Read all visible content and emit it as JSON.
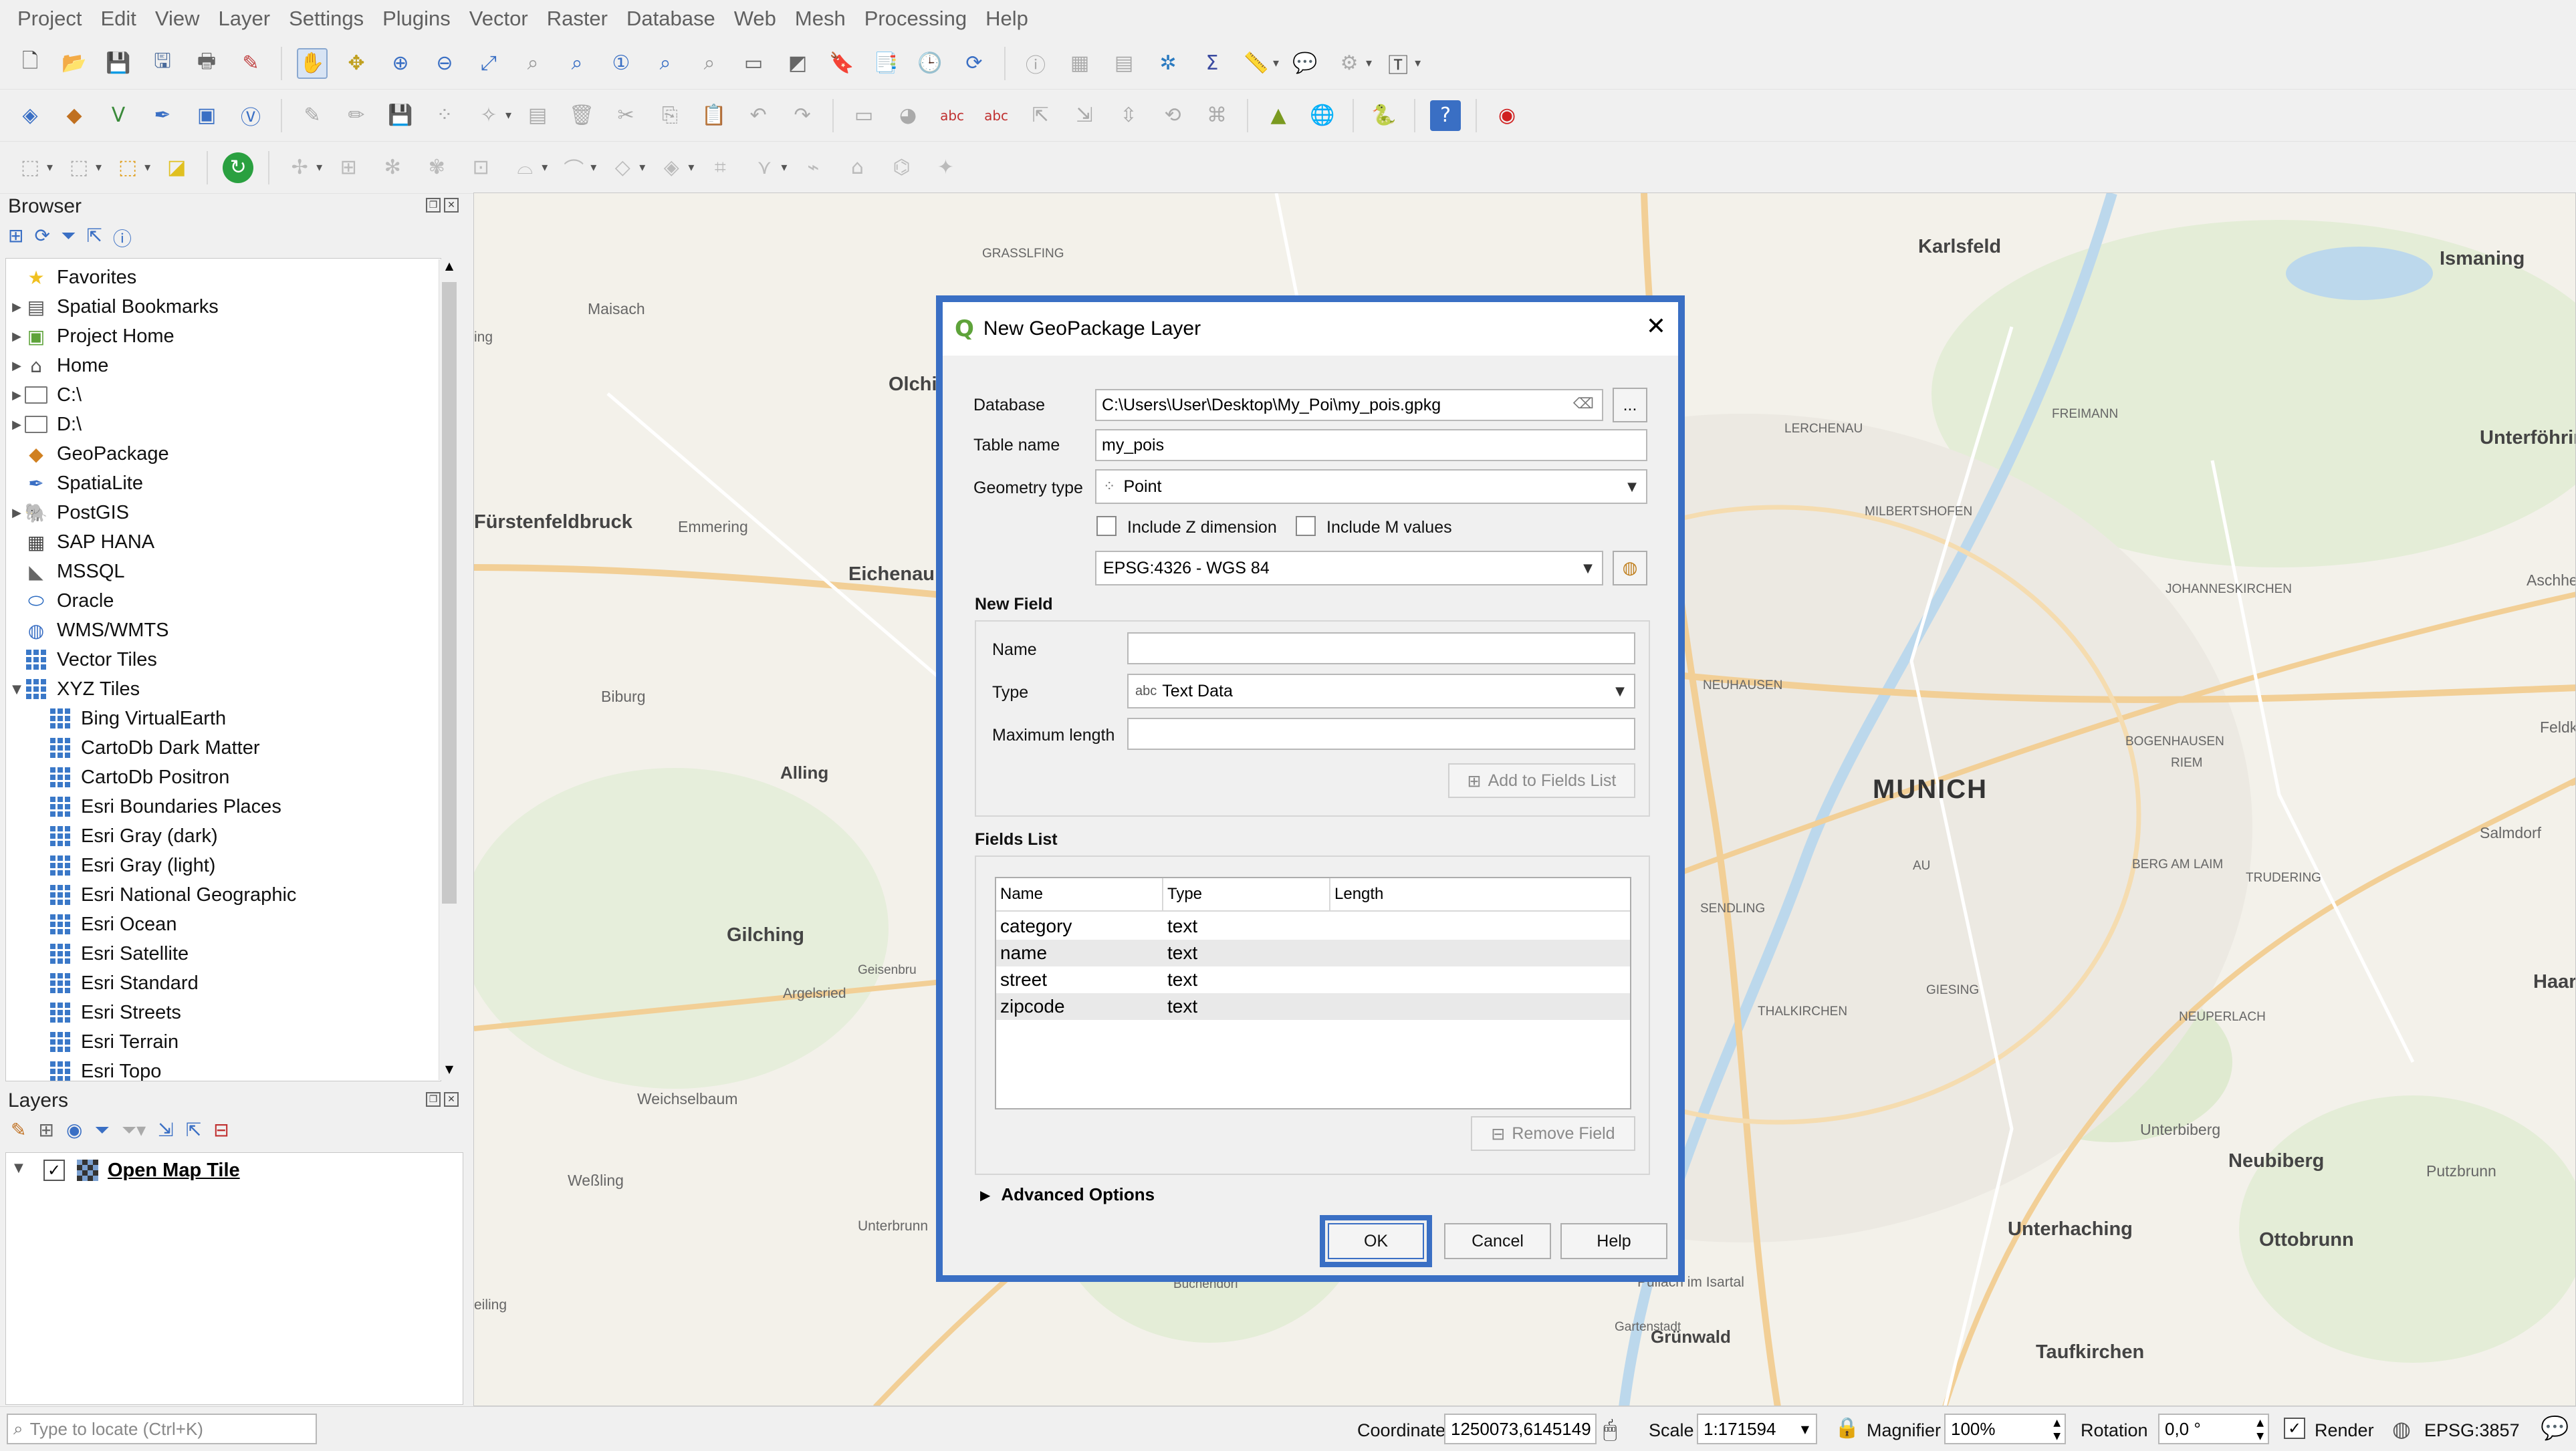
{
  "menu": [
    "Project",
    "Edit",
    "View",
    "Layer",
    "Settings",
    "Plugins",
    "Vector",
    "Raster",
    "Database",
    "Web",
    "Mesh",
    "Processing",
    "Help"
  ],
  "browser": {
    "title": "Browser",
    "items": [
      {
        "label": "Favorites",
        "icon": "star-icon"
      },
      {
        "label": "Spatial Bookmarks",
        "icon": "bookmark-icon"
      },
      {
        "label": "Project Home",
        "icon": "project-home-icon"
      },
      {
        "label": "Home",
        "icon": "home-icon"
      },
      {
        "label": "C:\\",
        "icon": "folder-icon"
      },
      {
        "label": "D:\\",
        "icon": "folder-icon"
      },
      {
        "label": "GeoPackage",
        "icon": "geopackage-icon"
      },
      {
        "label": "SpatiaLite",
        "icon": "spatialite-icon"
      },
      {
        "label": "PostGIS",
        "icon": "postgis-icon"
      },
      {
        "label": "SAP HANA",
        "icon": "sap-hana-icon"
      },
      {
        "label": "MSSQL",
        "icon": "mssql-icon"
      },
      {
        "label": "Oracle",
        "icon": "oracle-icon"
      },
      {
        "label": "WMS/WMTS",
        "icon": "globe-icon"
      },
      {
        "label": "Vector Tiles",
        "icon": "grid-icon"
      },
      {
        "label": "XYZ Tiles",
        "icon": "grid-icon"
      },
      {
        "label": "Bing VirtualEarth",
        "icon": "grid-icon"
      },
      {
        "label": "CartoDb Dark Matter",
        "icon": "grid-icon"
      },
      {
        "label": "CartoDb Positron",
        "icon": "grid-icon"
      },
      {
        "label": "Esri Boundaries Places",
        "icon": "grid-icon"
      },
      {
        "label": "Esri Gray (dark)",
        "icon": "grid-icon"
      },
      {
        "label": "Esri Gray (light)",
        "icon": "grid-icon"
      },
      {
        "label": "Esri National Geographic",
        "icon": "grid-icon"
      },
      {
        "label": "Esri Ocean",
        "icon": "grid-icon"
      },
      {
        "label": "Esri Satellite",
        "icon": "grid-icon"
      },
      {
        "label": "Esri Standard",
        "icon": "grid-icon"
      },
      {
        "label": "Esri Streets",
        "icon": "grid-icon"
      },
      {
        "label": "Esri Terrain",
        "icon": "grid-icon"
      },
      {
        "label": "Esri Topo",
        "icon": "grid-icon"
      }
    ]
  },
  "layers": {
    "title": "Layers",
    "items": [
      {
        "label": "Open Map Tile",
        "checked": true
      }
    ]
  },
  "map_labels": [
    {
      "text": "Karlsfeld"
    },
    {
      "text": "Ismaning"
    },
    {
      "text": "GRASSLFING"
    },
    {
      "text": "Maisach"
    },
    {
      "text": "Olchi"
    },
    {
      "text": "Unterföhring"
    },
    {
      "text": "FREIMANN"
    },
    {
      "text": "LERCHENAU"
    },
    {
      "text": "Fürstenfeldbruck"
    },
    {
      "text": "Emmering"
    },
    {
      "text": "Eichenau"
    },
    {
      "text": "MILBERTSHOFEN"
    },
    {
      "text": "Aschheim"
    },
    {
      "text": "JOHANNESKIRCHEN"
    },
    {
      "text": "NEUHAUSEN"
    },
    {
      "text": "Biburg"
    },
    {
      "text": "BOGENHAUSEN"
    },
    {
      "text": "Feldkirc"
    },
    {
      "text": "Alling"
    },
    {
      "text": "MUNICH"
    },
    {
      "text": "RIEM"
    },
    {
      "text": "Salmdorf"
    },
    {
      "text": "AU"
    },
    {
      "text": "BERG AM LAIM"
    },
    {
      "text": "TRUDERING"
    },
    {
      "text": "SENDLING"
    },
    {
      "text": "Gilching"
    },
    {
      "text": "Geisenbru"
    },
    {
      "text": "Haar"
    },
    {
      "text": "Argelsried"
    },
    {
      "text": "GIESING"
    },
    {
      "text": "THALKIRCHEN"
    },
    {
      "text": "NEUPERLACH"
    },
    {
      "text": "Weichselbaum"
    },
    {
      "text": "Unterbiberg"
    },
    {
      "text": "Neubiberg"
    },
    {
      "text": "Putzbrunn"
    },
    {
      "text": "Weßling"
    },
    {
      "text": "Unterbrunn"
    },
    {
      "text": "Unterhaching"
    },
    {
      "text": "Ottobrunn"
    },
    {
      "text": "eiling"
    },
    {
      "text": "Buchendorf"
    },
    {
      "text": "Pullach im Isartal"
    },
    {
      "text": "Gartenstadt"
    },
    {
      "text": "Grünwald"
    },
    {
      "text": "Taufkirchen"
    },
    {
      "text": "ing"
    }
  ],
  "dialog": {
    "title": "New GeoPackage Layer",
    "database_label": "Database",
    "database_value": "C:\\Users\\User\\Desktop\\My_Poi\\my_pois.gpkg",
    "browse_label": "...",
    "table_name_label": "Table name",
    "table_name_value": "my_pois",
    "geometry_type_label": "Geometry type",
    "geometry_type_value": "Point",
    "include_z_label": "Include Z dimension",
    "include_m_label": "Include M values",
    "crs_value": "EPSG:4326 - WGS 84",
    "new_field": {
      "title": "New Field",
      "name_label": "Name",
      "name_value": "",
      "type_label": "Type",
      "type_prefix": "abc",
      "type_value": "Text Data",
      "maxlen_label": "Maximum length",
      "maxlen_value": "",
      "add_button": "Add to Fields List"
    },
    "fields_list": {
      "title": "Fields List",
      "columns": [
        "Name",
        "Type",
        "Length"
      ],
      "rows": [
        {
          "name": "category",
          "type": "text",
          "length": ""
        },
        {
          "name": "name",
          "type": "text",
          "length": ""
        },
        {
          "name": "street",
          "type": "text",
          "length": ""
        },
        {
          "name": "zipcode",
          "type": "text",
          "length": ""
        }
      ],
      "remove_button": "Remove Field"
    },
    "advanced_label": "Advanced Options",
    "ok": "OK",
    "cancel": "Cancel",
    "help": "Help"
  },
  "statusbar": {
    "locate_placeholder": "Type to locate (Ctrl+K)",
    "coordinate_label": "Coordinate",
    "coordinate_value": "1250073,6145149",
    "scale_label": "Scale",
    "scale_value": "1:171594",
    "magnifier_label": "Magnifier",
    "magnifier_value": "100%",
    "rotation_label": "Rotation",
    "rotation_value": "0,0 °",
    "render_label": "Render",
    "crs_label": "EPSG:3857"
  },
  "colors": {
    "accent": "#3a6fc4",
    "map_background": "#f3f1ea",
    "water": "#bcd8ec",
    "green": "#d9e8c8",
    "road": "#f5d6a0"
  }
}
